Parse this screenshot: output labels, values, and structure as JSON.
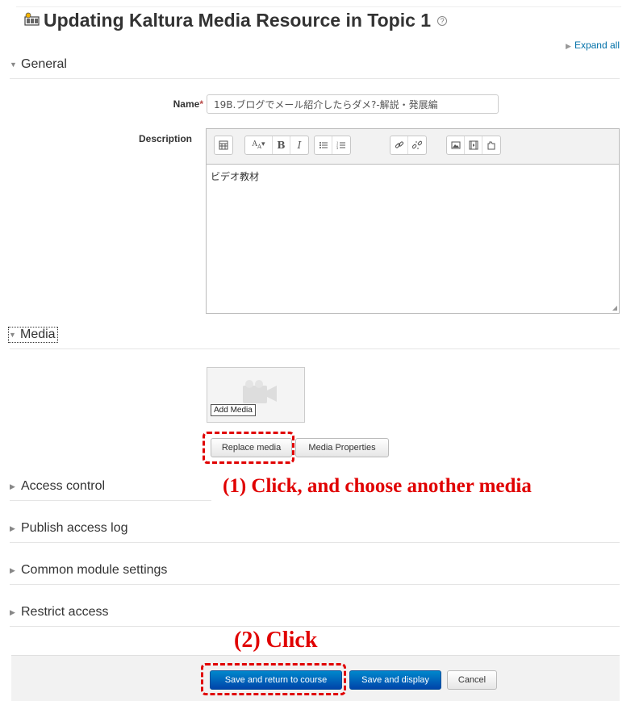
{
  "page": {
    "title": "Updating Kaltura Media Resource in Topic 1",
    "help_icon": "?",
    "expand_all": "Expand all"
  },
  "sections": {
    "general": "General",
    "media": "Media",
    "access_control": "Access control",
    "publish_access_log": "Publish access log",
    "common_module_settings": "Common module settings",
    "restrict_access": "Restrict access"
  },
  "form": {
    "name_label": "Name",
    "required_mark": "*",
    "name_value": "19B.ブログでメール紹介したらダメ?-解説・発展編",
    "description_label": "Description",
    "description_text": "ビデオ教材"
  },
  "editor_toolbar": [
    "table-icon",
    "font-size-icon",
    "bold-icon",
    "italic-icon",
    "bullet-list-icon",
    "numbered-list-icon",
    "link-icon",
    "unlink-icon",
    "image-icon",
    "media-icon",
    "manage-files-icon"
  ],
  "media": {
    "add_media_label": "Add Media",
    "replace_button": "Replace media",
    "properties_button": "Media Properties"
  },
  "annotations": {
    "step1": "(1) Click, and choose another media",
    "step2": "(2) Click"
  },
  "footer": {
    "save_return": "Save and return to course",
    "save_display": "Save and display",
    "cancel": "Cancel"
  },
  "colors": {
    "annotation": "#e00000",
    "primary_button": "#0055b3",
    "link": "#0070a8"
  }
}
